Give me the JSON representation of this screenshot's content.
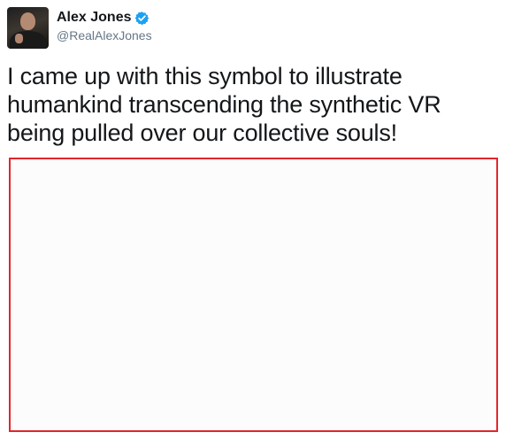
{
  "tweet": {
    "author": {
      "display_name": "Alex Jones",
      "handle": "@RealAlexJones",
      "verified": true,
      "avatar_icon": "profile-photo",
      "verified_icon": "verified-badge-icon"
    },
    "text": "I came up with this symbol to illustrate humankind transcending the synthetic VR being pulled over our collective souls!",
    "media": {
      "border_color": "#e0262b",
      "fill_color": "#fcfcfc"
    }
  },
  "colors": {
    "verified_blue": "#1da1f2",
    "text_primary": "#14171a",
    "text_secondary": "#657786"
  }
}
